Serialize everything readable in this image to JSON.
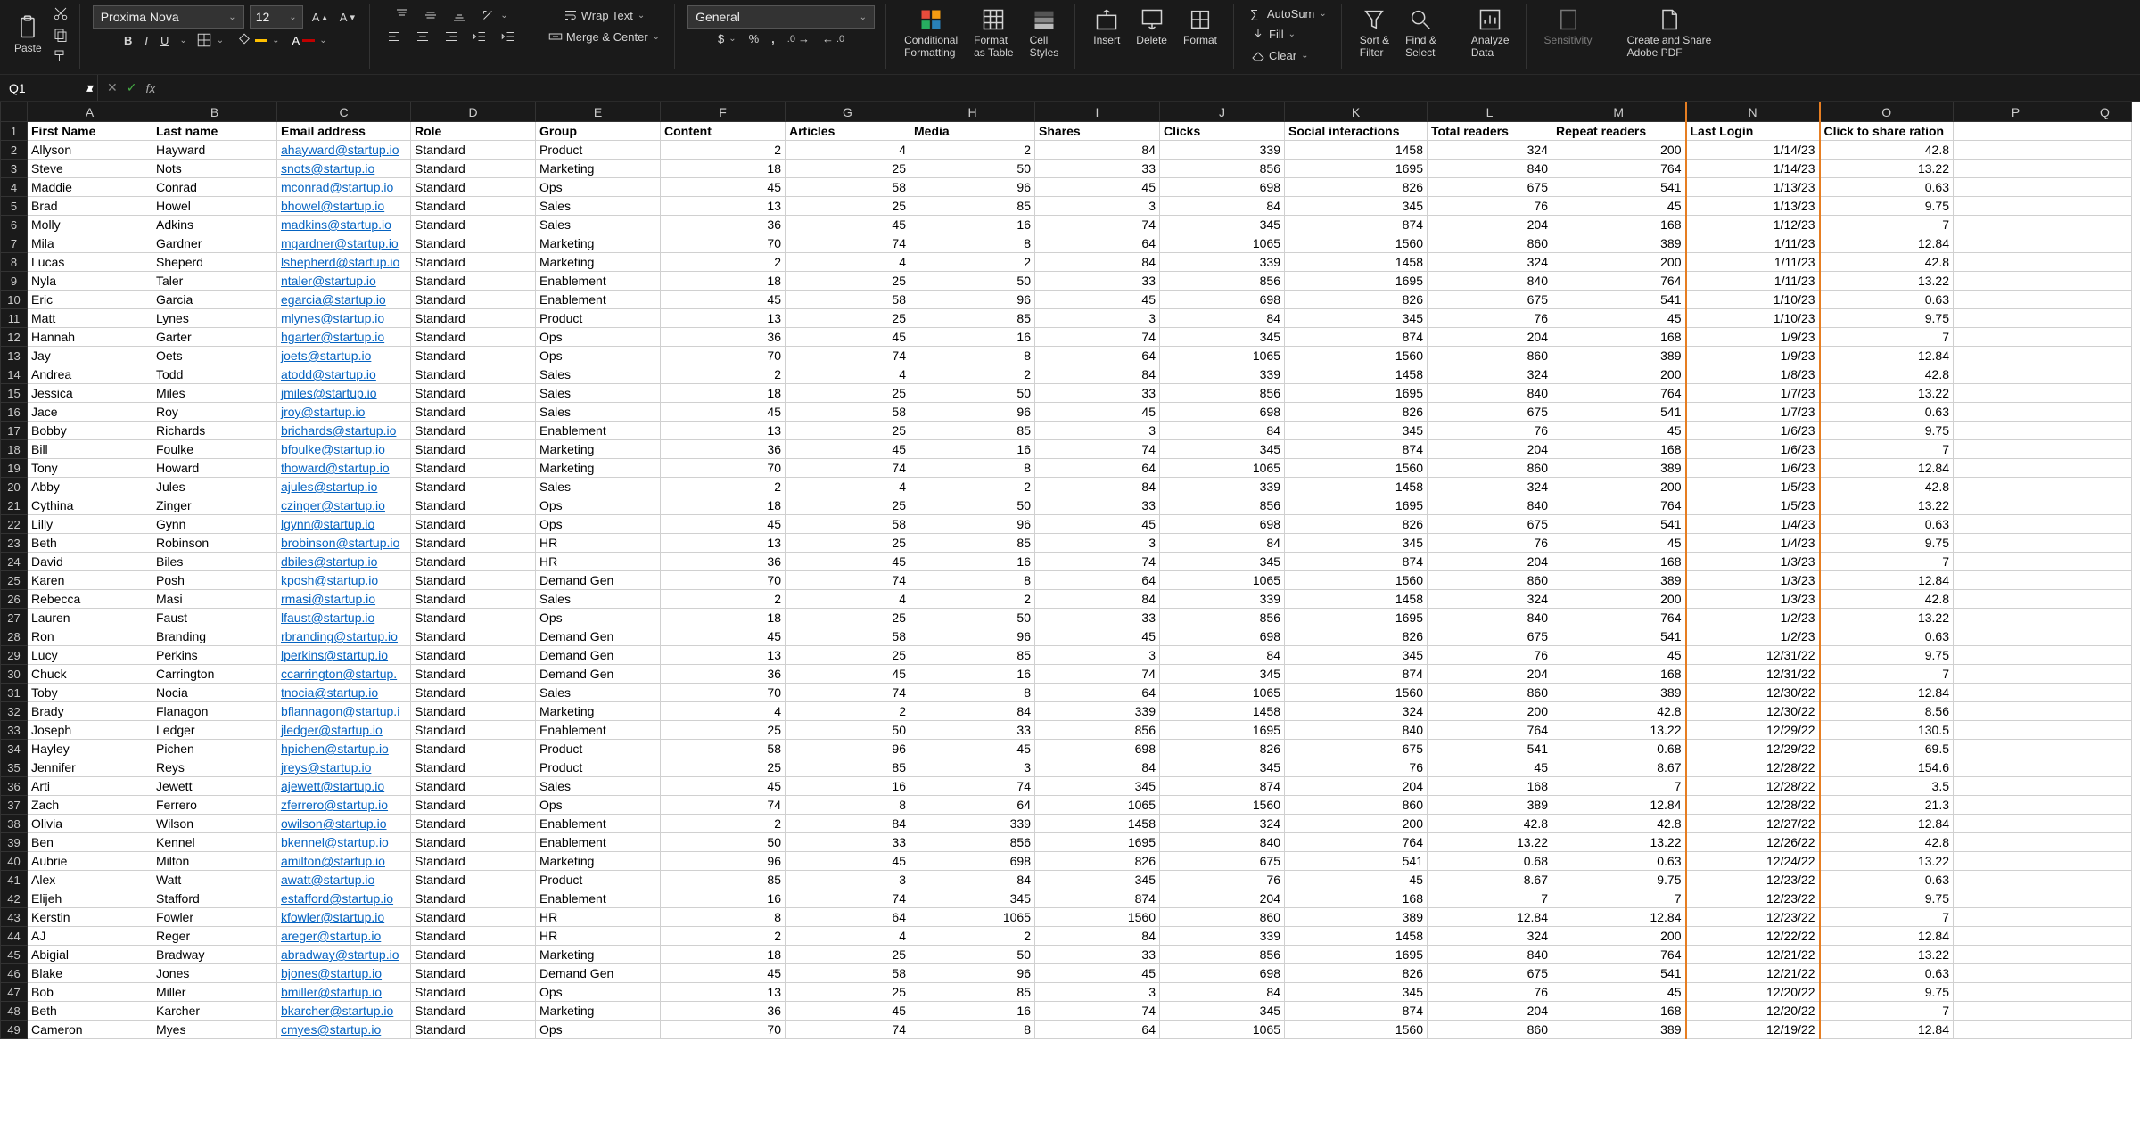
{
  "ribbon": {
    "paste": "Paste",
    "font_name": "Proxima Nova",
    "font_size": "12",
    "wrap": "Wrap Text",
    "merge": "Merge & Center",
    "numfmt": "General",
    "cond": "Conditional",
    "cond2": "Formatting",
    "fmt_table": "Format",
    "fmt_table2": "as Table",
    "cell_styles": "Cell",
    "cell_styles2": "Styles",
    "insert": "Insert",
    "delete": "Delete",
    "format": "Format",
    "autosum": "AutoSum",
    "fill": "Fill",
    "clear": "Clear",
    "sort": "Sort &",
    "sort2": "Filter",
    "find": "Find &",
    "find2": "Select",
    "analyze": "Analyze",
    "analyze2": "Data",
    "sens": "Sensitivity",
    "pdf": "Create and Share",
    "pdf2": "Adobe PDF"
  },
  "namebox": "Q1",
  "columns": [
    "A",
    "B",
    "C",
    "D",
    "E",
    "F",
    "G",
    "H",
    "I",
    "J",
    "K",
    "L",
    "M",
    "N",
    "O",
    "P",
    "Q"
  ],
  "headers": [
    "First Name",
    "Last name",
    "Email address",
    "Role",
    "Group",
    "Content",
    "Articles",
    "Media",
    "Shares",
    "Clicks",
    "Social interactions",
    "Total readers",
    "Repeat readers",
    "Last Login",
    "Click to share ration",
    "",
    ""
  ],
  "rows": [
    [
      "Allyson",
      "Hayward",
      "ahayward@startup.io",
      "Standard",
      "Product",
      "2",
      "4",
      "2",
      "84",
      "339",
      "1458",
      "324",
      "200",
      "1/14/23",
      "42.8"
    ],
    [
      "Steve",
      "Nots",
      "snots@startup.io",
      "Standard",
      "Marketing",
      "18",
      "25",
      "50",
      "33",
      "856",
      "1695",
      "840",
      "764",
      "1/14/23",
      "13.22"
    ],
    [
      "Maddie",
      "Conrad",
      "mconrad@startup.io",
      "Standard",
      "Ops",
      "45",
      "58",
      "96",
      "45",
      "698",
      "826",
      "675",
      "541",
      "1/13/23",
      "0.63"
    ],
    [
      "Brad",
      "Howel",
      "bhowel@startup.io",
      "Standard",
      "Sales",
      "13",
      "25",
      "85",
      "3",
      "84",
      "345",
      "76",
      "45",
      "1/13/23",
      "9.75"
    ],
    [
      "Molly",
      "Adkins",
      "madkins@startup.io",
      "Standard",
      "Sales",
      "36",
      "45",
      "16",
      "74",
      "345",
      "874",
      "204",
      "168",
      "1/12/23",
      "7"
    ],
    [
      "Mila",
      "Gardner",
      "mgardner@startup.io",
      "Standard",
      "Marketing",
      "70",
      "74",
      "8",
      "64",
      "1065",
      "1560",
      "860",
      "389",
      "1/11/23",
      "12.84"
    ],
    [
      "Lucas",
      "Sheperd",
      "lshepherd@startup.io",
      "Standard",
      "Marketing",
      "2",
      "4",
      "2",
      "84",
      "339",
      "1458",
      "324",
      "200",
      "1/11/23",
      "42.8"
    ],
    [
      "Nyla",
      "Taler",
      "ntaler@startup.io",
      "Standard",
      "Enablement",
      "18",
      "25",
      "50",
      "33",
      "856",
      "1695",
      "840",
      "764",
      "1/11/23",
      "13.22"
    ],
    [
      "Eric",
      "Garcia",
      "egarcia@startup.io",
      "Standard",
      "Enablement",
      "45",
      "58",
      "96",
      "45",
      "698",
      "826",
      "675",
      "541",
      "1/10/23",
      "0.63"
    ],
    [
      "Matt",
      "Lynes",
      "mlynes@startup.io",
      "Standard",
      "Product",
      "13",
      "25",
      "85",
      "3",
      "84",
      "345",
      "76",
      "45",
      "1/10/23",
      "9.75"
    ],
    [
      "Hannah",
      "Garter",
      "hgarter@startup.io",
      "Standard",
      "Ops",
      "36",
      "45",
      "16",
      "74",
      "345",
      "874",
      "204",
      "168",
      "1/9/23",
      "7"
    ],
    [
      "Jay",
      "Oets",
      "joets@startup.io",
      "Standard",
      "Ops",
      "70",
      "74",
      "8",
      "64",
      "1065",
      "1560",
      "860",
      "389",
      "1/9/23",
      "12.84"
    ],
    [
      "Andrea",
      "Todd",
      "atodd@startup.io",
      "Standard",
      "Sales",
      "2",
      "4",
      "2",
      "84",
      "339",
      "1458",
      "324",
      "200",
      "1/8/23",
      "42.8"
    ],
    [
      "Jessica",
      "Miles",
      "jmiles@startup.io",
      "Standard",
      "Sales",
      "18",
      "25",
      "50",
      "33",
      "856",
      "1695",
      "840",
      "764",
      "1/7/23",
      "13.22"
    ],
    [
      "Jace",
      "Roy",
      "jroy@startup.io",
      "Standard",
      "Sales",
      "45",
      "58",
      "96",
      "45",
      "698",
      "826",
      "675",
      "541",
      "1/7/23",
      "0.63"
    ],
    [
      "Bobby",
      "Richards",
      "brichards@startup.io",
      "Standard",
      "Enablement",
      "13",
      "25",
      "85",
      "3",
      "84",
      "345",
      "76",
      "45",
      "1/6/23",
      "9.75"
    ],
    [
      "Bill",
      "Foulke",
      "bfoulke@startup.io",
      "Standard",
      "Marketing",
      "36",
      "45",
      "16",
      "74",
      "345",
      "874",
      "204",
      "168",
      "1/6/23",
      "7"
    ],
    [
      "Tony",
      "Howard",
      "thoward@startup.io",
      "Standard",
      "Marketing",
      "70",
      "74",
      "8",
      "64",
      "1065",
      "1560",
      "860",
      "389",
      "1/6/23",
      "12.84"
    ],
    [
      "Abby",
      "Jules",
      "ajules@startup.io",
      "Standard",
      "Sales",
      "2",
      "4",
      "2",
      "84",
      "339",
      "1458",
      "324",
      "200",
      "1/5/23",
      "42.8"
    ],
    [
      "Cythina",
      "Zinger",
      "czinger@startup.io",
      "Standard",
      "Ops",
      "18",
      "25",
      "50",
      "33",
      "856",
      "1695",
      "840",
      "764",
      "1/5/23",
      "13.22"
    ],
    [
      "Lilly",
      "Gynn",
      "lgynn@startup.io",
      "Standard",
      "Ops",
      "45",
      "58",
      "96",
      "45",
      "698",
      "826",
      "675",
      "541",
      "1/4/23",
      "0.63"
    ],
    [
      "Beth",
      "Robinson",
      "brobinson@startup.io",
      "Standard",
      "HR",
      "13",
      "25",
      "85",
      "3",
      "84",
      "345",
      "76",
      "45",
      "1/4/23",
      "9.75"
    ],
    [
      "David",
      "Biles",
      "dbiles@startup.io",
      "Standard",
      "HR",
      "36",
      "45",
      "16",
      "74",
      "345",
      "874",
      "204",
      "168",
      "1/3/23",
      "7"
    ],
    [
      "Karen",
      "Posh",
      "kposh@startup.io",
      "Standard",
      "Demand Gen",
      "70",
      "74",
      "8",
      "64",
      "1065",
      "1560",
      "860",
      "389",
      "1/3/23",
      "12.84"
    ],
    [
      "Rebecca",
      "Masi",
      "rmasi@startup.io",
      "Standard",
      "Sales",
      "2",
      "4",
      "2",
      "84",
      "339",
      "1458",
      "324",
      "200",
      "1/3/23",
      "42.8"
    ],
    [
      "Lauren",
      "Faust",
      "lfaust@startup.io",
      "Standard",
      "Ops",
      "18",
      "25",
      "50",
      "33",
      "856",
      "1695",
      "840",
      "764",
      "1/2/23",
      "13.22"
    ],
    [
      "Ron",
      "Branding",
      "rbranding@startup.io",
      "Standard",
      "Demand Gen",
      "45",
      "58",
      "96",
      "45",
      "698",
      "826",
      "675",
      "541",
      "1/2/23",
      "0.63"
    ],
    [
      "Lucy",
      "Perkins",
      "lperkins@startup.io",
      "Standard",
      "Demand Gen",
      "13",
      "25",
      "85",
      "3",
      "84",
      "345",
      "76",
      "45",
      "12/31/22",
      "9.75"
    ],
    [
      "Chuck",
      "Carrington",
      "ccarrington@startup.",
      "Standard",
      "Demand Gen",
      "36",
      "45",
      "16",
      "74",
      "345",
      "874",
      "204",
      "168",
      "12/31/22",
      "7"
    ],
    [
      "Toby",
      "Nocia",
      "tnocia@startup.io",
      "Standard",
      "Sales",
      "70",
      "74",
      "8",
      "64",
      "1065",
      "1560",
      "860",
      "389",
      "12/30/22",
      "12.84"
    ],
    [
      "Brady",
      "Flanagon",
      "bflannagon@startup.i",
      "Standard",
      "Marketing",
      "4",
      "2",
      "84",
      "339",
      "1458",
      "324",
      "200",
      "42.8",
      "12/30/22",
      "8.56"
    ],
    [
      "Joseph",
      "Ledger",
      "jledger@startup.io",
      "Standard",
      "Enablement",
      "25",
      "50",
      "33",
      "856",
      "1695",
      "840",
      "764",
      "13.22",
      "12/29/22",
      "130.5"
    ],
    [
      "Hayley",
      "Pichen",
      "hpichen@startup.io",
      "Standard",
      "Product",
      "58",
      "96",
      "45",
      "698",
      "826",
      "675",
      "541",
      "0.68",
      "12/29/22",
      "69.5"
    ],
    [
      "Jennifer",
      "Reys",
      "jreys@startup.io",
      "Standard",
      "Product",
      "25",
      "85",
      "3",
      "84",
      "345",
      "76",
      "45",
      "8.67",
      "12/28/22",
      "154.6"
    ],
    [
      "Arti",
      "Jewett",
      "ajewett@startup.io",
      "Standard",
      "Sales",
      "45",
      "16",
      "74",
      "345",
      "874",
      "204",
      "168",
      "7",
      "12/28/22",
      "3.5"
    ],
    [
      "Zach",
      "Ferrero",
      "zferrero@startup.io",
      "Standard",
      "Ops",
      "74",
      "8",
      "64",
      "1065",
      "1560",
      "860",
      "389",
      "12.84",
      "12/28/22",
      "21.3"
    ],
    [
      "Olivia",
      "Wilson",
      "owilson@startup.io",
      "Standard",
      "Enablement",
      "2",
      "84",
      "339",
      "1458",
      "324",
      "200",
      "42.8",
      "42.8",
      "12/27/22",
      "12.84"
    ],
    [
      "Ben",
      "Kennel",
      "bkennel@startup.io",
      "Standard",
      "Enablement",
      "50",
      "33",
      "856",
      "1695",
      "840",
      "764",
      "13.22",
      "13.22",
      "12/26/22",
      "42.8"
    ],
    [
      "Aubrie",
      "Milton",
      "amilton@startup.io",
      "Standard",
      "Marketing",
      "96",
      "45",
      "698",
      "826",
      "675",
      "541",
      "0.68",
      "0.63",
      "12/24/22",
      "13.22"
    ],
    [
      "Alex",
      "Watt",
      "awatt@startup.io",
      "Standard",
      "Product",
      "85",
      "3",
      "84",
      "345",
      "76",
      "45",
      "8.67",
      "9.75",
      "12/23/22",
      "0.63"
    ],
    [
      "Elijeh",
      "Stafford",
      "estafford@startup.io",
      "Standard",
      "Enablement",
      "16",
      "74",
      "345",
      "874",
      "204",
      "168",
      "7",
      "7",
      "12/23/22",
      "9.75"
    ],
    [
      "Kerstin",
      "Fowler",
      "kfowler@startup.io",
      "Standard",
      "HR",
      "8",
      "64",
      "1065",
      "1560",
      "860",
      "389",
      "12.84",
      "12.84",
      "12/23/22",
      "7"
    ],
    [
      "AJ",
      "Reger",
      "areger@startup.io",
      "Standard",
      "HR",
      "2",
      "4",
      "2",
      "84",
      "339",
      "1458",
      "324",
      "200",
      "12/22/22",
      "12.84"
    ],
    [
      "Abigial",
      "Bradway",
      "abradway@startup.io",
      "Standard",
      "Marketing",
      "18",
      "25",
      "50",
      "33",
      "856",
      "1695",
      "840",
      "764",
      "12/21/22",
      "13.22"
    ],
    [
      "Blake",
      "Jones",
      "bjones@startup.io",
      "Standard",
      "Demand Gen",
      "45",
      "58",
      "96",
      "45",
      "698",
      "826",
      "675",
      "541",
      "12/21/22",
      "0.63"
    ],
    [
      "Bob",
      "Miller",
      "bmiller@startup.io",
      "Standard",
      "Ops",
      "13",
      "25",
      "85",
      "3",
      "84",
      "345",
      "76",
      "45",
      "12/20/22",
      "9.75"
    ],
    [
      "Beth",
      "Karcher",
      "bkarcher@startup.io",
      "Standard",
      "Marketing",
      "36",
      "45",
      "16",
      "74",
      "345",
      "874",
      "204",
      "168",
      "12/20/22",
      "7"
    ],
    [
      "Cameron",
      "Myes",
      "cmyes@startup.io",
      "Standard",
      "Ops",
      "70",
      "74",
      "8",
      "64",
      "1065",
      "1560",
      "860",
      "389",
      "12/19/22",
      "12.84"
    ]
  ]
}
